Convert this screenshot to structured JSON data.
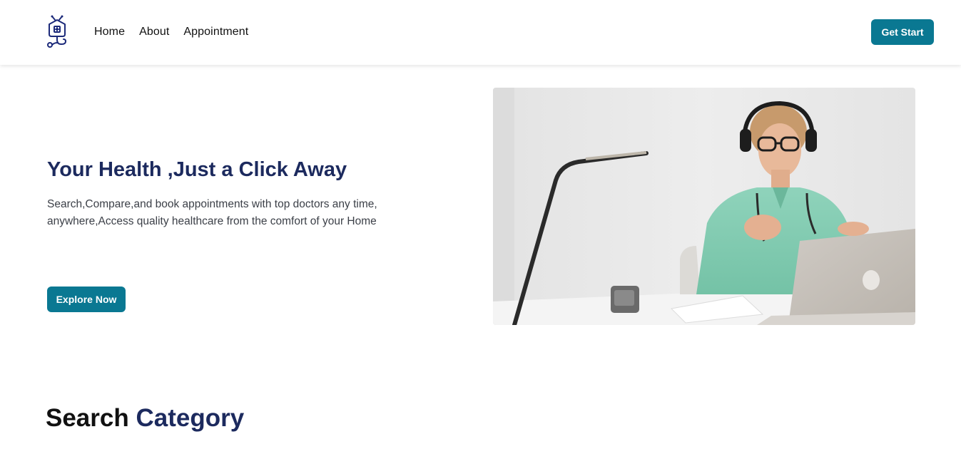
{
  "navbar": {
    "logo_icon": "medical-house-stethoscope-icon",
    "links": [
      "Home",
      "About",
      "Appointment"
    ],
    "cta_label": "Get Start"
  },
  "hero": {
    "title": "Your Health ,Just a Click Away",
    "description": "Search,Compare,and book appointments with top doctors any time, anywhere,Access quality healthcare from the comfort of your Home",
    "button_label": "Explore Now",
    "image_description_icon": "doctor-telehealth-photo"
  },
  "section": {
    "title_part1": "Search",
    "title_part2": "Category"
  },
  "colors": {
    "primary": "#0a7892",
    "heading": "#1c2a5e",
    "text": "#3c4048"
  }
}
